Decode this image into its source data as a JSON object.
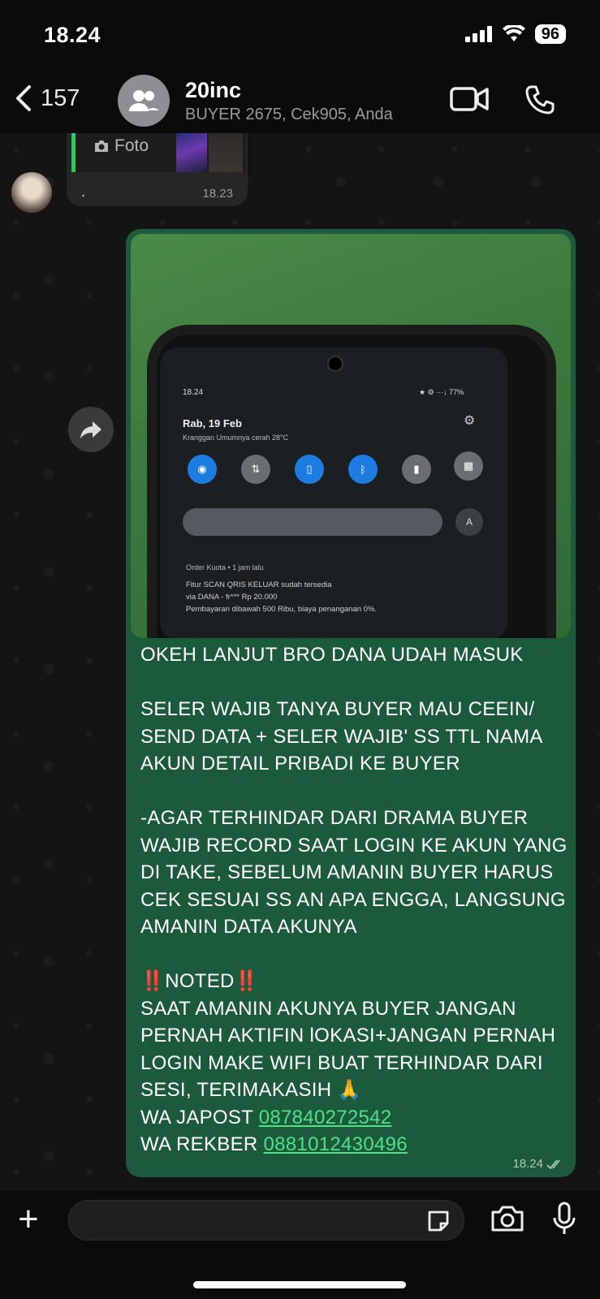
{
  "status_bar": {
    "time": "18.24",
    "battery": "96"
  },
  "header": {
    "back_count": "157",
    "title": "20inc",
    "subtitle": "BUYER 2675, Cek905, Anda"
  },
  "prev_message": {
    "quote_label": "Foto",
    "text": ".",
    "time": "18.23"
  },
  "photo_screen": {
    "time": "18.24",
    "status": "★ ⚙ ···↓ 77%",
    "date": "Rab, 19 Feb",
    "weather": "Kranggan Umumnya cerah 28°C",
    "brightness_auto": "A",
    "notif_header": "Order Kuota • 1 jam lalu",
    "notif_line1": "Fitur SCAN QRIS KELUAR sudah tersedia",
    "notif_line2": "via DANA - fr*** Rp 20.000",
    "notif_line3": "Pembayaran dibawah 500 Ribu, biaya penanganan 0%."
  },
  "message": {
    "p1": "OKEH LANJUT BRO DANA UDAH MASUK",
    "p2": "SELER WAJIB TANYA BUYER MAU CEEIN/ SEND DATA + SELER WAJIB' SS TTL NAMA AKUN DETAIL PRIBADI KE BUYER",
    "p3": "-AGAR TERHINDAR DARI DRAMA BUYER WAJIB RECORD SAAT LOGIN KE AKUN YANG DI TAKE, SEBELUM AMANIN BUYER HARUS CEK SESUAI SS AN APA ENGGA, LANGSUNG AMANIN DATA AKUNYA",
    "noted": "NOTED",
    "noted_mark": "‼️",
    "p4": "SAAT AMANIN AKUNYA BUYER JANGAN PERNAH AKTIFIN lOKASI+JANGAN PERNAH LOGIN MAKE WIFI BUAT TERHINDAR DARI SESI, TERIMAKASIH 🙏",
    "wa_japost_label": "WA JAPOST ",
    "wa_japost_number": "087840272542",
    "wa_rekber_label": "WA REKBER ",
    "wa_rekber_number": "0881012430496",
    "time": "18.24"
  },
  "colors": {
    "bubble": "#1b5a3b",
    "link": "#4fe08a",
    "accent": "#36c46a"
  }
}
